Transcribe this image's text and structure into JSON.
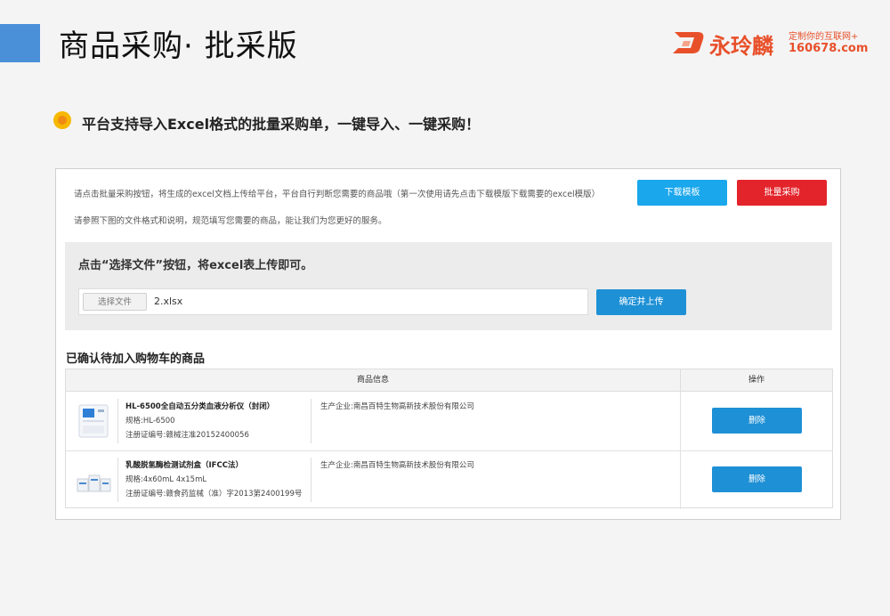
{
  "header": {
    "title": "商品采购· 批采版",
    "logo_name": "永玲麟",
    "logo_slogan": "定制你的互联网+",
    "logo_url": "160678.com"
  },
  "headline": "平台支持导入Excel格式的批量采购单，一键导入、一键采购！",
  "panel": {
    "intro_line1": "请点击批量采购按钮，将生成的excel文档上传给平台，平台自行判断您需要的商品哦（第一次使用请先点击下载模版下载需要的excel模版）",
    "intro_line2": "请参照下图的文件格式和说明，规范填写您需要的商品，能让我们为您更好的服务。",
    "download_template_label": "下载模板",
    "batch_purchase_label": "批量采购",
    "upload": {
      "title": "点击“选择文件”按钮，将excel表上传即可。",
      "choose_file_label": "选择文件",
      "file_name": "2.xlsx",
      "confirm_upload_label": "确定并上传"
    },
    "cart": {
      "title": "已确认待加入购物车的商品",
      "col_info": "商品信息",
      "col_op": "操作",
      "rows": [
        {
          "name": "HL-6500全自动五分类血液分析仪（封闭）",
          "spec": "规格:HL-6500",
          "reg": "注册证编号:赣械注准20152400056",
          "maker": "生产企业:南昌百特生物高新技术股份有限公司",
          "delete_label": "删除"
        },
        {
          "name": "乳酸脱氢酶检测试剂盒（IFCC法）",
          "spec": "规格:4x60mL 4x15mL",
          "reg": "注册证编号:赣食药监械（准）字2013第2400199号",
          "maker": "生产企业:南昌百特生物高新技术股份有限公司",
          "delete_label": "删除"
        }
      ]
    }
  },
  "colors": {
    "accent_blue": "#1aa7ec",
    "button_blue": "#1e90d5",
    "danger_red": "#e3242b",
    "bullet_orange": "#f6b800",
    "logo_orange": "#e8502a",
    "title_bar_blue": "#4a90d9"
  }
}
